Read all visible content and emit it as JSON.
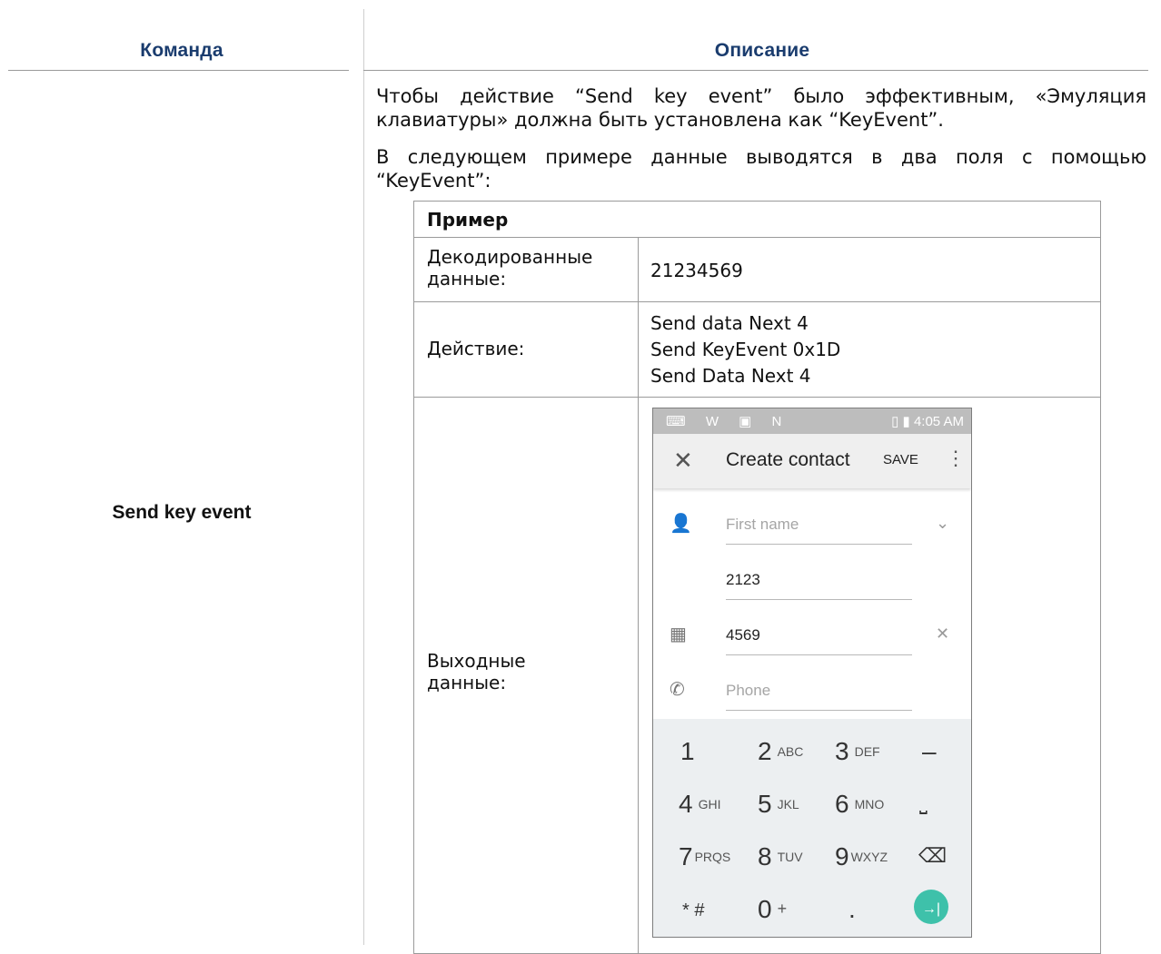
{
  "header": {
    "col1": "Команда",
    "col2": "Описание"
  },
  "command": "Send key event",
  "desc": {
    "para1_line1": "Чтобы действие “Send key event” было эффективным, «Эмуляция",
    "para1_line2": "клавиатуры» должна быть установлена как “KeyEvent”.",
    "para2_line1": "В следующем примере данные выводятся в два поля с помощью",
    "para2_line2": "“KeyEvent”:"
  },
  "example": {
    "title": "Пример",
    "decoded_label_1": "Декодированные",
    "decoded_label_2": "данные:",
    "decoded_value": "21234569",
    "action_label": "Действие:",
    "action_lines": [
      "Send data Next 4",
      "Send KeyEvent 0x1D",
      "Send Data Next 4"
    ],
    "output_label_1": "Выходные",
    "output_label_2": "данные:"
  },
  "phone": {
    "status_icons": "⌨ W ▣ N",
    "status_time": "4:05 AM",
    "appbar_title": "Create contact",
    "save": "SAVE",
    "fields": [
      {
        "icon": "person-icon",
        "glyph": "👤",
        "text": "First name",
        "placeholder": true,
        "trailing": "⌄"
      },
      {
        "icon": "",
        "glyph": "",
        "text": "2123",
        "placeholder": false,
        "trailing": ""
      },
      {
        "icon": "business-icon",
        "glyph": "▦",
        "text": "4569",
        "placeholder": false,
        "trailing": "✕"
      },
      {
        "icon": "phone-icon",
        "glyph": "✆",
        "text": "Phone",
        "placeholder": true,
        "trailing": ""
      }
    ],
    "keys": [
      {
        "main": "1",
        "sub": ""
      },
      {
        "main": "2",
        "sub": "ABC"
      },
      {
        "main": "3",
        "sub": "DEF"
      },
      {
        "main": "–",
        "sub": ""
      },
      {
        "main": "4",
        "sub": "GHI"
      },
      {
        "main": "5",
        "sub": "JKL"
      },
      {
        "main": "6",
        "sub": "MNO"
      },
      {
        "main": "⎵",
        "sub": ""
      },
      {
        "main": "7",
        "sub": "PRQS"
      },
      {
        "main": "8",
        "sub": "TUV"
      },
      {
        "main": "9",
        "sub": "WXYZ"
      },
      {
        "main": "⌫",
        "sub": ""
      },
      {
        "main": "* #",
        "sub": ""
      },
      {
        "main": "0",
        "sub": "+"
      },
      {
        "main": ".",
        "sub": ""
      },
      {
        "main": "→|",
        "sub": ""
      }
    ]
  }
}
